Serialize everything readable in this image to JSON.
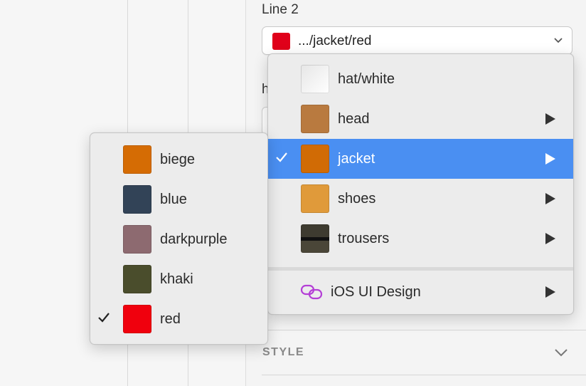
{
  "inspector": {
    "field_label": "Line 2",
    "hidden_label": "h",
    "select": {
      "value": ".../jacket/red",
      "swatch_color": "#e0001a"
    },
    "style_section": "STYLE"
  },
  "menu": {
    "items": [
      {
        "label": "hat/white",
        "color": "#f4f4f4",
        "has_submenu": false,
        "selected": false
      },
      {
        "label": "head",
        "color": "#b97a3f",
        "has_submenu": true,
        "selected": false
      },
      {
        "label": "jacket",
        "color": "#d16b05",
        "has_submenu": true,
        "selected": true
      },
      {
        "label": "shoes",
        "color": "#e09a3a",
        "has_submenu": true,
        "selected": false
      },
      {
        "label": "trousers",
        "color": "#38362c",
        "has_submenu": true,
        "selected": false
      }
    ],
    "library": {
      "label": "iOS UI Design",
      "icon": "link-icon",
      "icon_color": "#b43fd6"
    },
    "selected_color": "#4a8ff2"
  },
  "submenu": {
    "items": [
      {
        "label": "biege",
        "color": "#d56c04",
        "checked": false
      },
      {
        "label": "blue",
        "color": "#324357",
        "checked": false
      },
      {
        "label": "darkpurple",
        "color": "#8d6a70",
        "checked": false
      },
      {
        "label": "khaki",
        "color": "#4a4d2c",
        "checked": false
      },
      {
        "label": "red",
        "color": "#f0000d",
        "checked": true
      }
    ]
  }
}
